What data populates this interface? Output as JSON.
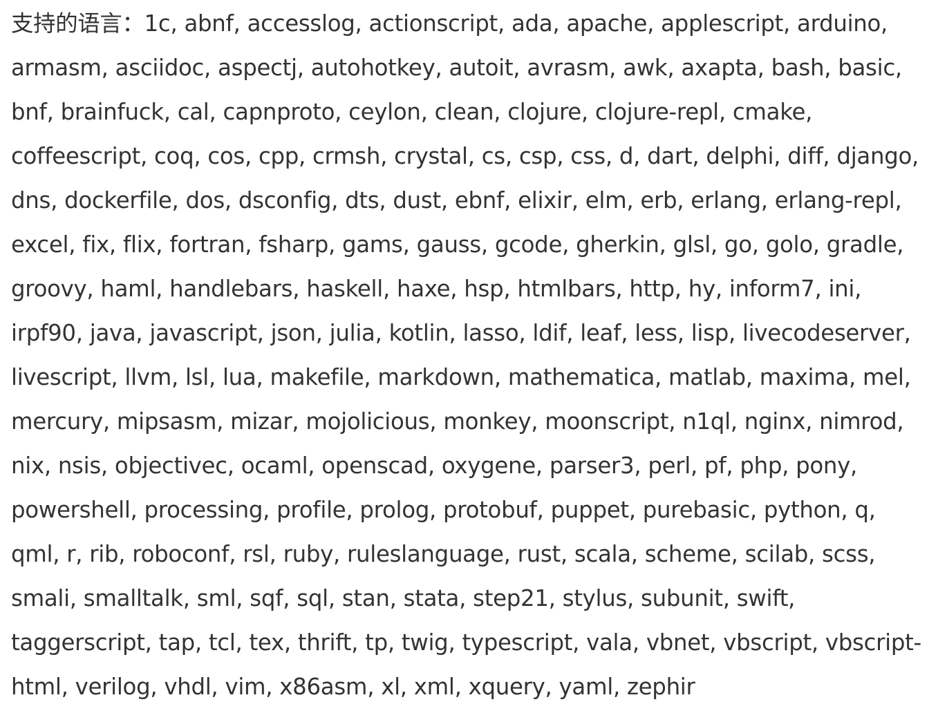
{
  "lines": [
    "支持的语言：1c, abnf, accesslog, actionscript, ada, apache, applescript, arduino,",
    "armasm, asciidoc, aspectj, autohotkey, autoit, avrasm, awk, axapta, bash, basic,",
    "bnf, brainfuck, cal, capnproto, ceylon, clean, clojure, clojure-repl, cmake,",
    "coffeescript, coq, cos, cpp, crmsh, crystal, cs, csp, css, d, dart, delphi, diff, django,",
    "dns, dockerfile, dos, dsconfig, dts, dust, ebnf, elixir, elm, erb, erlang, erlang-repl,",
    "excel, fix, flix, fortran, fsharp, gams, gauss, gcode, gherkin, glsl, go, golo, gradle,",
    "groovy, haml, handlebars, haskell, haxe, hsp, htmlbars, http, hy, inform7, ini,",
    "irpf90, java, javascript, json, julia, kotlin, lasso, ldif, leaf, less, lisp, livecodeserver,",
    "livescript, llvm, lsl, lua, makefile, markdown, mathematica, matlab, maxima, mel,",
    "mercury, mipsasm, mizar, mojolicious, monkey, moonscript, n1ql, nginx, nimrod,",
    "nix, nsis, objectivec, ocaml, openscad, oxygene, parser3, perl, pf, php, pony,",
    "powershell, processing, profile, prolog, protobuf, puppet, purebasic, python, q,",
    "qml, r, rib, roboconf, rsl, ruby, ruleslanguage, rust, scala, scheme, scilab, scss,",
    "smali, smalltalk, sml, sqf, sql, stan, stata, step21, stylus, subunit, swift,",
    "taggerscript, tap, tcl, tex, thrift, tp, twig, typescript, vala, vbnet, vbscript, vbscript-",
    "html, verilog, vhdl, vim, x86asm, xl, xml, xquery, yaml, zephir"
  ]
}
